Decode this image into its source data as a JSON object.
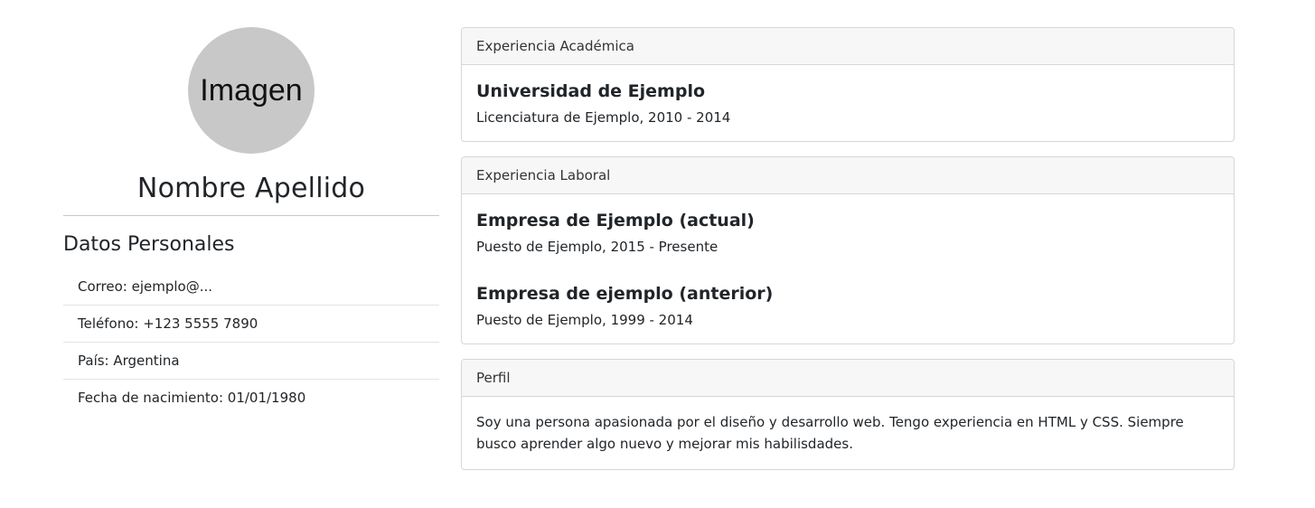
{
  "profile": {
    "avatar_text": "Imagen",
    "name": "Nombre Apellido"
  },
  "personal": {
    "title": "Datos Personales",
    "items": [
      "Correo: ejemplo@...",
      "Teléfono: +123 5555 7890",
      "País: Argentina",
      "Fecha de nacimiento: 01/01/1980"
    ]
  },
  "academic": {
    "header": "Experiencia Académica",
    "entries": [
      {
        "title": "Universidad de Ejemplo",
        "sub": "Licenciatura de Ejemplo, 2010 - 2014"
      }
    ]
  },
  "work": {
    "header": "Experiencia Laboral",
    "entries": [
      {
        "title": "Empresa de Ejemplo (actual)",
        "sub": "Puesto de Ejemplo, 2015 - Presente"
      },
      {
        "title": "Empresa de ejemplo (anterior)",
        "sub": "Puesto de Ejemplo, 1999 - 2014"
      }
    ]
  },
  "bio": {
    "header": "Perfil",
    "text": "Soy una persona apasionada por el diseño y desarrollo web. Tengo experiencia en HTML y CSS. Siempre busco aprender algo nuevo y mejorar mis habilisdades."
  }
}
